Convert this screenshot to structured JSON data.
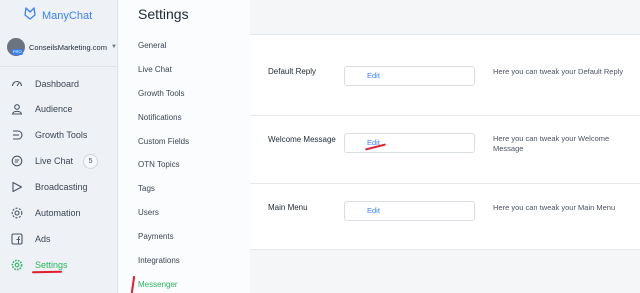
{
  "brand": {
    "name": "ManyChat",
    "logo_icon": "manychat-logo-icon",
    "accent": "#3b82f6"
  },
  "account": {
    "name": "ConseilsMarketing.com",
    "badge": "PRO"
  },
  "sidebar": {
    "items": [
      {
        "label": "Dashboard",
        "icon": "dashboard-icon"
      },
      {
        "label": "Audience",
        "icon": "audience-icon"
      },
      {
        "label": "Growth Tools",
        "icon": "growth-tools-icon"
      },
      {
        "label": "Live Chat",
        "icon": "live-chat-icon",
        "count": "5"
      },
      {
        "label": "Broadcasting",
        "icon": "broadcasting-icon"
      },
      {
        "label": "Automation",
        "icon": "automation-icon"
      },
      {
        "label": "Ads",
        "icon": "ads-icon"
      },
      {
        "label": "Settings",
        "icon": "settings-icon",
        "active": true
      }
    ],
    "active_color": "#28b562"
  },
  "settings": {
    "title": "Settings",
    "items": [
      {
        "label": "General"
      },
      {
        "label": "Live Chat"
      },
      {
        "label": "Growth Tools"
      },
      {
        "label": "Notifications"
      },
      {
        "label": "Custom Fields"
      },
      {
        "label": "OTN Topics"
      },
      {
        "label": "Tags"
      },
      {
        "label": "Users"
      },
      {
        "label": "Payments"
      },
      {
        "label": "Integrations"
      },
      {
        "label": "Messenger",
        "active": true
      }
    ]
  },
  "main": {
    "rows": [
      {
        "title": "Default Reply",
        "edit_label": "Edit",
        "description": "Here you can tweak your Default Reply"
      },
      {
        "title": "Welcome Message",
        "edit_label": "Edit",
        "description": "Here you can tweak your Welcome Message"
      },
      {
        "title": "Main Menu",
        "edit_label": "Edit",
        "description": "Here you can tweak your Main Menu"
      }
    ]
  },
  "annotation_color": "#e11d2e"
}
